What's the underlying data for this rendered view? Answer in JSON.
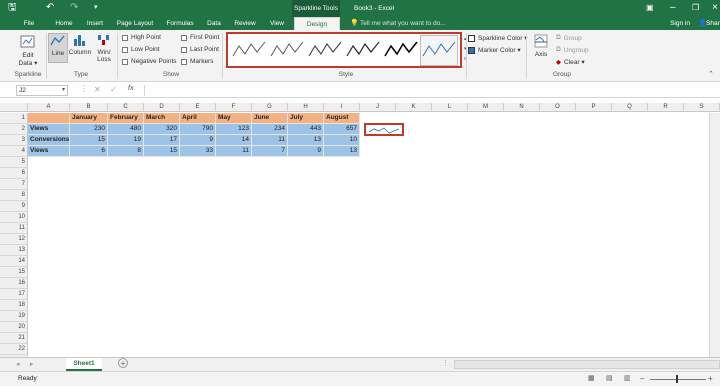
{
  "titlebar": {
    "context_tab": "Sparkline Tools",
    "doc_title": "Book3 - Excel"
  },
  "tabs": [
    {
      "label": "File"
    },
    {
      "label": "Home"
    },
    {
      "label": "Insert"
    },
    {
      "label": "Page Layout"
    },
    {
      "label": "Formulas"
    },
    {
      "label": "Data"
    },
    {
      "label": "Review"
    },
    {
      "label": "View"
    },
    {
      "label": "Design"
    }
  ],
  "tell_me": "Tell me what you want to do...",
  "signin": "Sign in",
  "share": "Shar",
  "ribbon": {
    "sparkline_group": {
      "edit_data": "Edit",
      "edit_data2": "Data ▾",
      "label": "Sparkline"
    },
    "type_group": {
      "line": "Line",
      "column": "Column",
      "winloss": "Win/",
      "winloss2": "Loss",
      "label": "Type"
    },
    "show_group": {
      "high_point": "High Point",
      "low_point": "Low Point",
      "negative_points": "Negative Points",
      "first_point": "First Point",
      "last_point": "Last Point",
      "markers": "Markers",
      "label": "Show"
    },
    "style_group": {
      "label": "Style"
    },
    "color_group": {
      "sparkline_color": "Sparkline Color ▾",
      "marker_color": "Marker Color ▾"
    },
    "group_group": {
      "axis": "Axis",
      "group": "Group",
      "ungroup": "Ungroup",
      "clear": "Clear ▾",
      "label": "Group"
    }
  },
  "formula_bar": {
    "name_box": "J2",
    "fx": "fx"
  },
  "columns": [
    "A",
    "B",
    "C",
    "D",
    "E",
    "F",
    "G",
    "H",
    "I",
    "J",
    "K",
    "L",
    "M",
    "N",
    "O",
    "P",
    "Q",
    "R",
    "S"
  ],
  "rows": [
    "1",
    "2",
    "3",
    "4",
    "5",
    "6",
    "7",
    "8",
    "9",
    "10",
    "11",
    "12",
    "13",
    "14",
    "15",
    "16",
    "17",
    "18",
    "19",
    "20",
    "21",
    "22",
    "23"
  ],
  "table": {
    "headers": [
      "January",
      "February",
      "March",
      "April",
      "May",
      "June",
      "July",
      "August"
    ],
    "rows": [
      {
        "label": "Views",
        "values": [
          "230",
          "480",
          "320",
          "790",
          "123",
          "234",
          "443",
          "657"
        ]
      },
      {
        "label": "Conversions",
        "values": [
          "15",
          "19",
          "17",
          "9",
          "14",
          "11",
          "13",
          "10"
        ]
      },
      {
        "label": "Views",
        "values": [
          "6",
          "8",
          "15",
          "33",
          "11",
          "7",
          "9",
          "13"
        ]
      }
    ]
  },
  "sheet_tab": "Sheet1",
  "status": "Ready",
  "accent": "#217346"
}
